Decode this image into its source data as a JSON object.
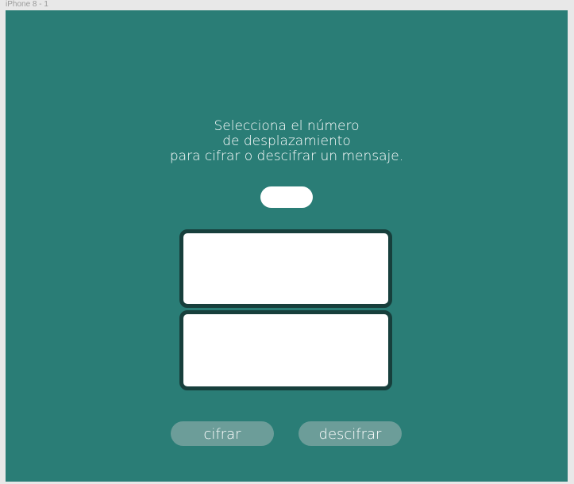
{
  "artboard": {
    "label": "iPhone 8 - 1",
    "background": "#2a7d76"
  },
  "instructions": {
    "line1": "Selecciona el número",
    "line2": "de desplazamiento",
    "line3": "para cifrar o descifrar un mensaje."
  },
  "shift": {
    "value": ""
  },
  "message_input": {
    "value": ""
  },
  "message_output": {
    "value": ""
  },
  "buttons": {
    "cifrar_label": "cifrar",
    "descifrar_label": "descifrar"
  },
  "colors": {
    "accent": "#2a7d76",
    "box_border": "#173f3c",
    "button_bg": "#6c9d99"
  }
}
